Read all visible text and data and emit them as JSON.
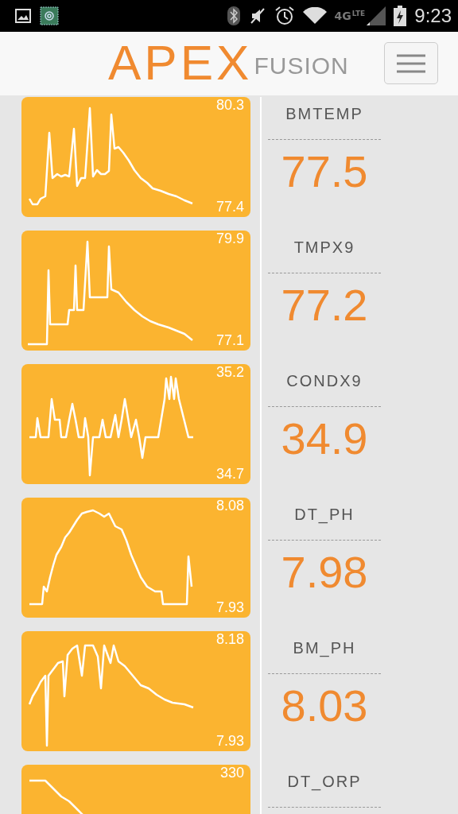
{
  "status_bar": {
    "network": "4G",
    "network_sub": "LTE",
    "time": "9:23"
  },
  "header": {
    "logo_primary": "APEX",
    "logo_secondary": "FUSION"
  },
  "probes": [
    {
      "name": "BMTEMP",
      "max": "80.3",
      "min": "77.4",
      "value": "77.5"
    },
    {
      "name": "TMPX9",
      "max": "79.9",
      "min": "77.1",
      "value": "77.2"
    },
    {
      "name": "CONDX9",
      "max": "35.2",
      "min": "34.7",
      "value": "34.9"
    },
    {
      "name": "DT_PH",
      "max": "8.08",
      "min": "7.93",
      "value": "7.98"
    },
    {
      "name": "BM_PH",
      "max": "8.18",
      "min": "7.93",
      "value": "8.03"
    },
    {
      "name": "DT_ORP",
      "max": "330"
    }
  ]
}
